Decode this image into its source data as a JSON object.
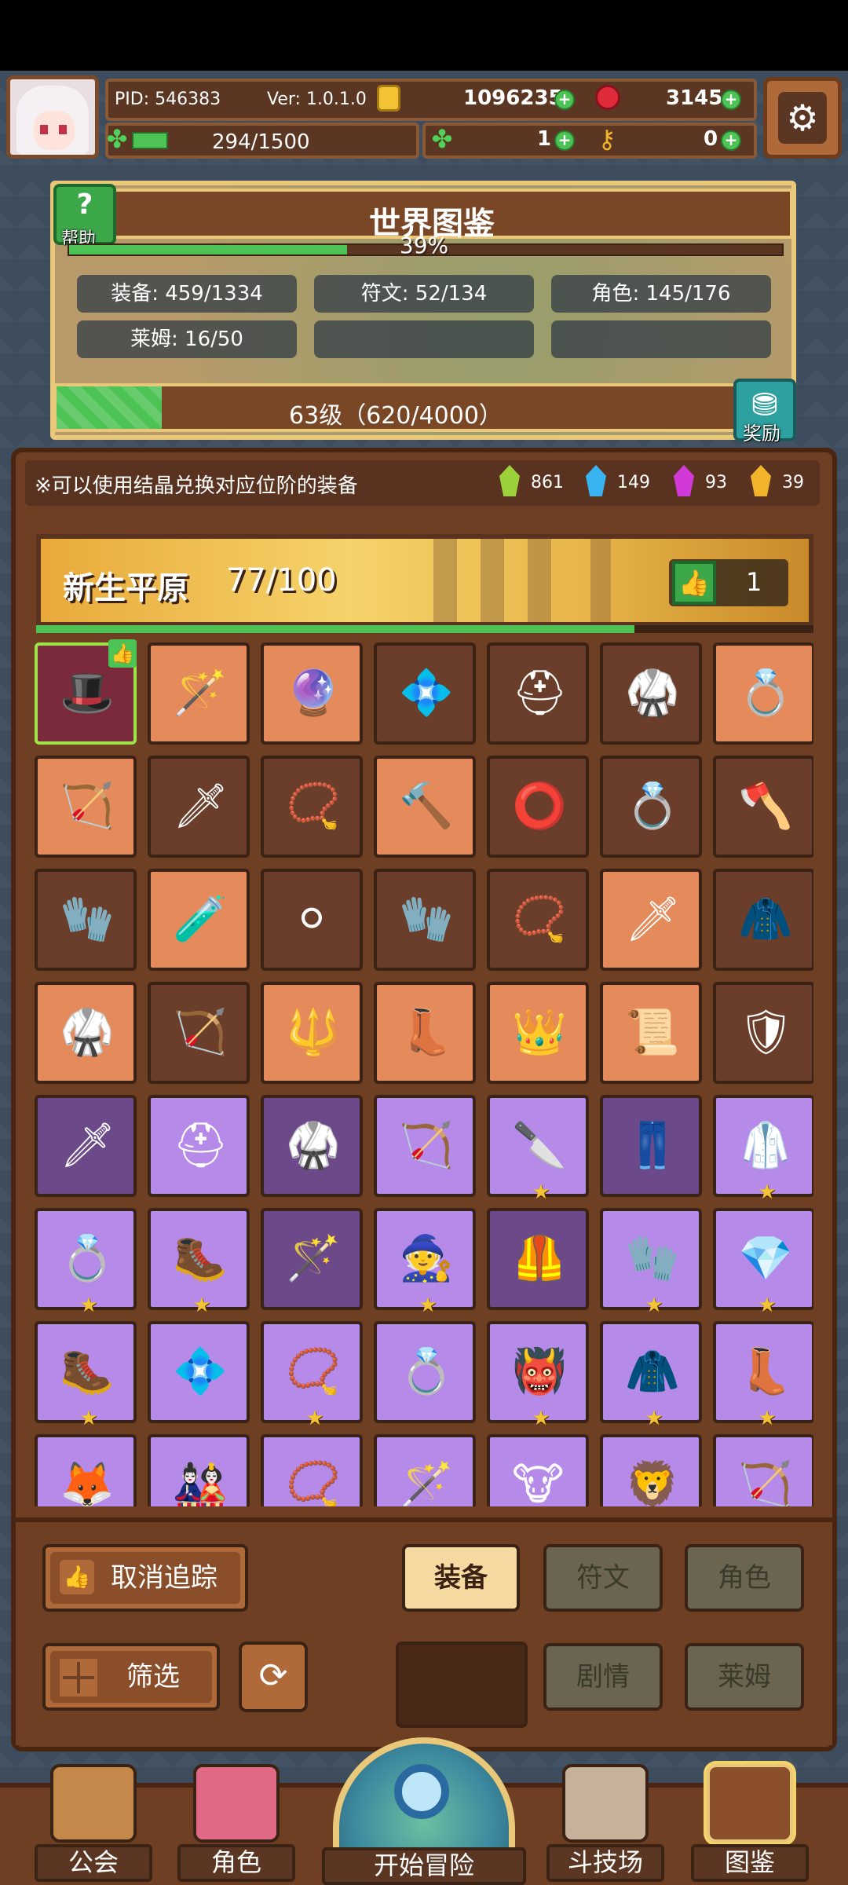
{
  "header": {
    "pid": "PID: 546383",
    "version": "Ver: 1.0.1.0",
    "gold": "1096235",
    "gems": "3145",
    "stamina": "294/1500",
    "clovers": "1",
    "keys": "0"
  },
  "world": {
    "title": "世界图鉴",
    "help_label": "帮助",
    "percent": "39%",
    "percent_value": 0.39,
    "stats": {
      "equipment": "装备: 459/1334",
      "runes": "符文: 52/134",
      "roles": "角色: 145/176",
      "slimes": "莱姆: 16/50"
    },
    "level_text": "63级（620/4000）",
    "level_progress": 0.155,
    "reward_label": "奖励"
  },
  "notice": {
    "text": "※可以使用结晶兑换对应位阶的装备",
    "crystals": [
      {
        "color": "#9bd13a",
        "count": "861"
      },
      {
        "color": "#3ab4f0",
        "count": "149"
      },
      {
        "color": "#d23ad8",
        "count": "93"
      },
      {
        "color": "#f2b42a",
        "count": "39"
      }
    ]
  },
  "region": {
    "name": "新生平原",
    "count": "77/100",
    "likes": "1",
    "progress": 0.77
  },
  "grid": {
    "rows": [
      [
        {
          "icon": "🎩",
          "rarity": "sel",
          "star": false
        },
        {
          "icon": "🪄",
          "rarity": "orange",
          "star": false
        },
        {
          "icon": "🔮",
          "rarity": "orange",
          "star": false
        },
        {
          "icon": "💠",
          "rarity": "dark",
          "star": false
        },
        {
          "icon": "⛑",
          "rarity": "dark",
          "star": false
        },
        {
          "icon": "🥋",
          "rarity": "dark",
          "star": false
        },
        {
          "icon": "💍",
          "rarity": "orange",
          "star": false
        }
      ],
      [
        {
          "icon": "🏹",
          "rarity": "orange",
          "star": false
        },
        {
          "icon": "🗡",
          "rarity": "dark",
          "star": false
        },
        {
          "icon": "📿",
          "rarity": "dark",
          "star": false
        },
        {
          "icon": "🔨",
          "rarity": "orange",
          "star": false
        },
        {
          "icon": "⭕",
          "rarity": "dark",
          "star": false
        },
        {
          "icon": "💍",
          "rarity": "dark",
          "star": false
        },
        {
          "icon": "🪓",
          "rarity": "dark",
          "star": false
        }
      ],
      [
        {
          "icon": "🧤",
          "rarity": "dark",
          "star": false
        },
        {
          "icon": "🧪",
          "rarity": "orange",
          "star": false
        },
        {
          "icon": "⚪",
          "rarity": "dark",
          "star": false
        },
        {
          "icon": "🧤",
          "rarity": "dark",
          "star": false
        },
        {
          "icon": "📿",
          "rarity": "dark",
          "star": false
        },
        {
          "icon": "🗡",
          "rarity": "orange",
          "star": false
        },
        {
          "icon": "🧥",
          "rarity": "dark",
          "star": false
        }
      ],
      [
        {
          "icon": "🥋",
          "rarity": "orange",
          "star": false
        },
        {
          "icon": "🏹",
          "rarity": "dark",
          "star": false
        },
        {
          "icon": "🔱",
          "rarity": "orange",
          "star": false
        },
        {
          "icon": "👢",
          "rarity": "orange",
          "star": false
        },
        {
          "icon": "👑",
          "rarity": "orange",
          "star": false
        },
        {
          "icon": "📜",
          "rarity": "orange",
          "star": false
        },
        {
          "icon": "🛡",
          "rarity": "dark",
          "star": false
        }
      ],
      [
        {
          "icon": "🗡",
          "rarity": "dpurple",
          "star": false
        },
        {
          "icon": "⛑",
          "rarity": "purple",
          "star": false
        },
        {
          "icon": "🥋",
          "rarity": "dpurple",
          "star": false
        },
        {
          "icon": "🏹",
          "rarity": "purple",
          "star": false
        },
        {
          "icon": "🔪",
          "rarity": "purple",
          "star": true
        },
        {
          "icon": "👖",
          "rarity": "dpurple",
          "star": false
        },
        {
          "icon": "🥼",
          "rarity": "purple",
          "star": true
        }
      ],
      [
        {
          "icon": "💍",
          "rarity": "purple",
          "star": true
        },
        {
          "icon": "🥾",
          "rarity": "purple",
          "star": true
        },
        {
          "icon": "🪄",
          "rarity": "dpurple",
          "star": false
        },
        {
          "icon": "🧙",
          "rarity": "purple",
          "star": true
        },
        {
          "icon": "🦺",
          "rarity": "dpurple",
          "star": false
        },
        {
          "icon": "🧤",
          "rarity": "purple",
          "star": true
        },
        {
          "icon": "💎",
          "rarity": "purple",
          "star": true
        }
      ],
      [
        {
          "icon": "🥾",
          "rarity": "purple",
          "star": true
        },
        {
          "icon": "💠",
          "rarity": "purple",
          "star": false
        },
        {
          "icon": "📿",
          "rarity": "purple",
          "star": true
        },
        {
          "icon": "💍",
          "rarity": "purple",
          "star": false
        },
        {
          "icon": "👹",
          "rarity": "purple",
          "star": true
        },
        {
          "icon": "🧥",
          "rarity": "purple",
          "star": true
        },
        {
          "icon": "👢",
          "rarity": "purple",
          "star": true
        }
      ],
      [
        {
          "icon": "🦊",
          "rarity": "purple",
          "star": false
        },
        {
          "icon": "🎎",
          "rarity": "purple",
          "star": false
        },
        {
          "icon": "📿",
          "rarity": "purple",
          "star": false
        },
        {
          "icon": "🪄",
          "rarity": "purple",
          "star": false
        },
        {
          "icon": "🐮",
          "rarity": "purple",
          "star": false
        },
        {
          "icon": "🦁",
          "rarity": "purple",
          "star": false
        },
        {
          "icon": "🏹",
          "rarity": "purple",
          "star": false
        }
      ]
    ]
  },
  "controls": {
    "untrack": "取消追踪",
    "filter": "筛选",
    "tab_equipment": "装备",
    "tab_runes": "符文",
    "tab_roles": "角色",
    "tab_story": "剧情",
    "tab_slime": "莱姆"
  },
  "nav": {
    "guild": "公会",
    "role": "角色",
    "adventure": "开始冒险",
    "arena": "斗技场",
    "codex": "图鉴"
  }
}
